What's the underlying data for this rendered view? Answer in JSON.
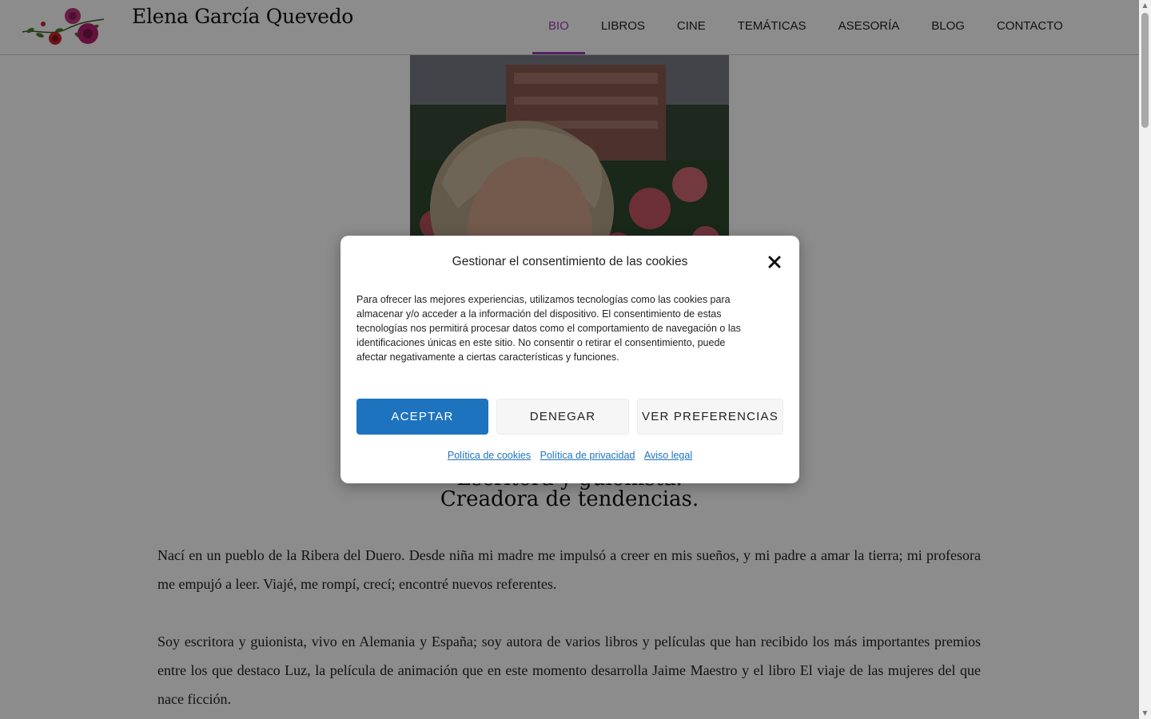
{
  "site": {
    "title": "Elena García Quevedo",
    "nav": [
      {
        "label": "BIO",
        "active": true
      },
      {
        "label": "LIBROS",
        "active": false
      },
      {
        "label": "CINE",
        "active": false
      },
      {
        "label": "TEMÁTICAS",
        "active": false
      },
      {
        "label": "ASESORÍA",
        "active": false
      },
      {
        "label": "BLOG",
        "active": false
      },
      {
        "label": "CONTACTO",
        "active": false
      }
    ]
  },
  "hero": {
    "subtitle_line1": "Escritora y guionista.",
    "subtitle_line2": "Creadora de tendencias."
  },
  "content": {
    "paragraphs": [
      "Nací en un pueblo de la Ribera del Duero. Desde niña mi madre me impulsó a creer en mis sueños, y mi padre a amar la tierra; mi profesora me empujó a leer. Viajé, me rompí, crecí; encontré nuevos referentes.",
      "Soy escritora y guionista, vivo en Alemania y España; soy autora de varios libros y películas que han recibido los más importantes premios entre los que destaco Luz, la película de animación que en este momento desarrolla Jaime Maestro y el libro El viaje de las mujeres del que nace ficción."
    ]
  },
  "cookie_modal": {
    "title": "Gestionar el consentimiento de las cookies",
    "body": "Para ofrecer las mejores experiencias, utilizamos tecnologías como las cookies para almacenar y/o acceder a la información del dispositivo. El consentimiento de estas tecnologías nos permitirá procesar datos como el comportamiento de navegación o las identificaciones únicas en este sitio. No consentir o retirar el consentimiento, puede afectar negativamente a ciertas características y funciones.",
    "accept_label": "ACEPTAR",
    "deny_label": "DENEGAR",
    "prefs_label": "VER PREFERENCIAS",
    "links": [
      "Política de cookies",
      "Política de privacidad",
      "Aviso legal"
    ]
  },
  "colors": {
    "accent_purple": "#9b3fb3",
    "button_blue": "#1e73be",
    "overlay": "rgba(0,0,0,0.45)"
  }
}
